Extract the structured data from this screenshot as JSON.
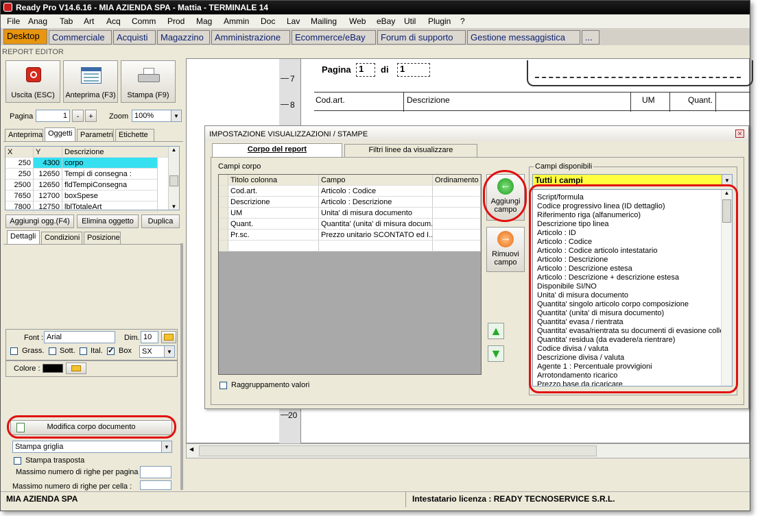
{
  "window": {
    "title": "Ready Pro V14.6.16 - MIA AZIENDA SPA - Mattia - TERMINALE 14"
  },
  "menu": [
    "File",
    "Anag",
    "Tab",
    "Art",
    "Acq",
    "Comm",
    "Prod",
    "Mag",
    "Ammin",
    "Doc",
    "Lav",
    "Mailing",
    "Web",
    "eBay",
    "Util",
    "Plugin",
    "?"
  ],
  "main_tabs": [
    "Desktop",
    "Commerciale",
    "Acquisti",
    "Magazzino",
    "Amministrazione",
    "Ecommerce/eBay",
    "Forum di supporto",
    "Gestione messaggistica",
    "..."
  ],
  "breadcrumb": "REPORT EDITOR",
  "toolbar": {
    "exit": "Uscita (ESC)",
    "preview": "Anteprima (F3)",
    "print": "Stampa (F9)"
  },
  "pager": {
    "page_label": "Pagina",
    "page_value": "1",
    "minus": "-",
    "plus": "+",
    "zoom_label": "Zoom",
    "zoom_value": "100%"
  },
  "left_tabs": [
    "Anteprima",
    "Oggetti",
    "Parametri",
    "Etichette"
  ],
  "objects_grid": {
    "headers": [
      "X",
      "Y",
      "Descrizione"
    ],
    "rows": [
      [
        "250",
        "4300",
        "corpo"
      ],
      [
        "250",
        "12650",
        "Tempi di consegna :"
      ],
      [
        "2500",
        "12650",
        "fldTempiConsegna"
      ],
      [
        "7650",
        "12700",
        "boxSpese"
      ],
      [
        "7800",
        "12750",
        "lblTotaleArt"
      ]
    ]
  },
  "obj_buttons": {
    "add": "Aggiungi ogg.(F4)",
    "delete": "Elimina oggetto",
    "duplicate": "Duplica"
  },
  "detail_tabs": [
    "Dettagli",
    "Condizioni",
    "Posizione"
  ],
  "font": {
    "label": "Font :",
    "value": "Arial",
    "dim_label": "Dim.",
    "dim_value": "10",
    "bold": "Grass.",
    "underline": "Sott.",
    "italic": "Ital.",
    "box": "Box",
    "align": "SX"
  },
  "color": {
    "label": "Colore :"
  },
  "edit_body_button": "Modifica corpo documento",
  "print_grid": {
    "value": "Stampa griglia"
  },
  "print_transposed": "Stampa trasposta",
  "max_rows_page": "Massimo numero di righe per pagina :",
  "max_rows_cell": "Massimo numero di righe per cella :",
  "report_header": {
    "page": "Pagina",
    "page_n": "1",
    "of": "di",
    "total": "1",
    "cols": [
      "Cod.art.",
      "Descrizione",
      "UM",
      "Quant."
    ],
    "ruler": [
      "7",
      "8",
      "20"
    ]
  },
  "dialog": {
    "title": "IMPOSTAZIONE VISUALIZZAZIONI / STAMPE",
    "tabs": [
      "Corpo del report",
      "Filtri linee da visualizzare"
    ],
    "body_fields_label": "Campi corpo",
    "grid_headers": [
      "Titolo colonna",
      "Campo",
      "Ordinamento"
    ],
    "grid_rows": [
      [
        "Cod.art.",
        "Articolo : Codice",
        ""
      ],
      [
        "Descrizione",
        "Articolo : Descrizione",
        ""
      ],
      [
        "UM",
        "Unita' di misura documento",
        ""
      ],
      [
        "Quant.",
        "Quantita' (unita' di misura docum...",
        ""
      ],
      [
        "Pr.sc.",
        "Prezzo unitario SCONTATO ed I...",
        ""
      ]
    ],
    "add_field": "Aggiungi campo",
    "remove_field": "Rimuovi campo",
    "group_values": "Raggruppamento valori",
    "available_label": "Campi disponibili",
    "filter_value": "Tutti i campi",
    "available_fields": [
      "Script/formula",
      "Codice progressivo linea (ID dettaglio)",
      "Riferimento riga (alfanumerico)",
      "Descrizione tipo linea",
      "Articolo : ID",
      "Articolo : Codice",
      "Articolo : Codice articolo intestatario",
      "Articolo : Descrizione",
      "Articolo : Descrizione estesa",
      "Articolo : Descrizione + descrizione estesa",
      "Disponibile SI/NO",
      "Unita' di misura documento",
      "Quantita' singolo articolo corpo composizione",
      "Quantita' (unita' di misura documento)",
      "Quantita' evasa / rientrata",
      "Quantita' evasa/rientrata su documenti di evasione colleg",
      "Quantita' residua (da evadere/a rientrare)",
      "Codice divisa / valuta",
      "Descrizione divisa / valuta",
      "Agente 1 : Percentuale provvigioni",
      "Arrotondamento ricarico",
      "Prezzo base da ricaricare"
    ]
  },
  "status": {
    "company": "MIA AZIENDA SPA",
    "license": "Intestatario licenza : READY TECNOSERVICE S.R.L."
  },
  "colors": {
    "accent_tab": "#e89510",
    "selected_row": "#35e0f0",
    "highlight_combo": "#ffff40",
    "annotation": "#e01010"
  }
}
